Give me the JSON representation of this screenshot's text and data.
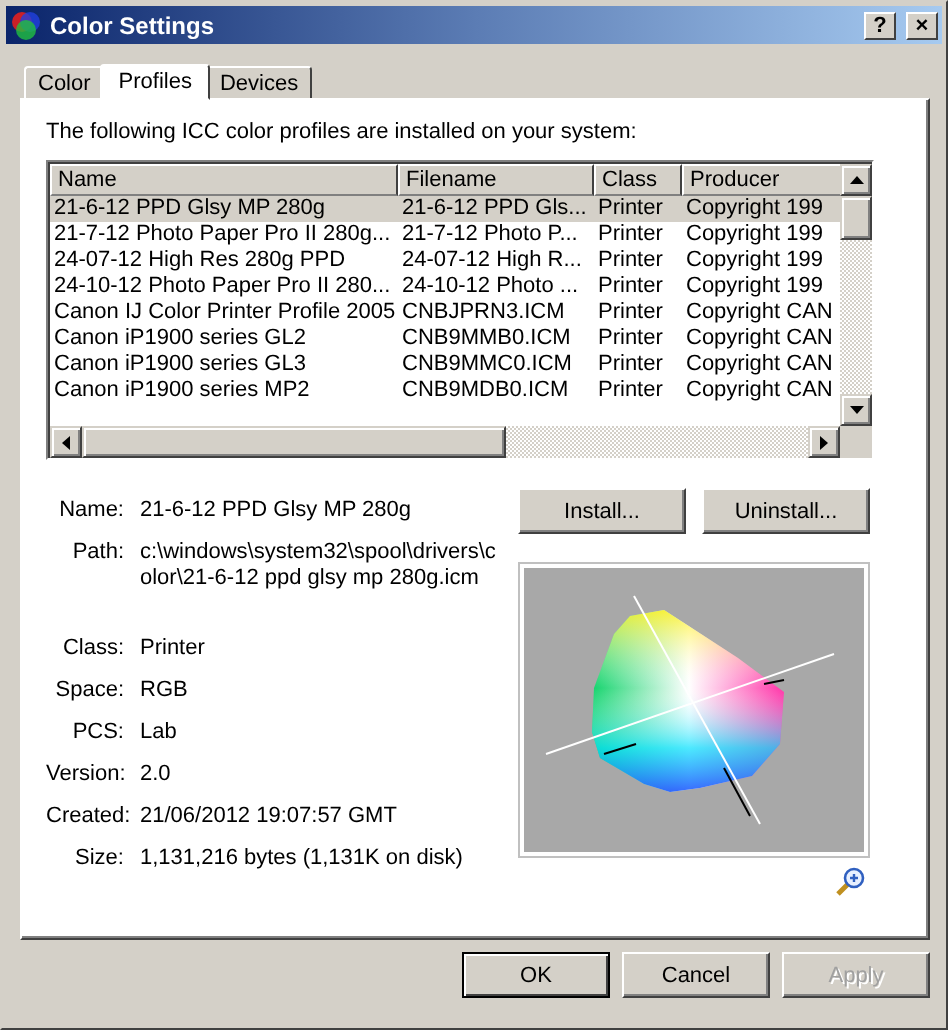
{
  "window": {
    "title": "Color Settings",
    "title_buttons": [
      "?",
      "×"
    ]
  },
  "tabs": [
    {
      "label": "Color",
      "selected": false
    },
    {
      "label": "Profiles",
      "selected": true
    },
    {
      "label": "Devices",
      "selected": false
    }
  ],
  "intro": "The following ICC color profiles are installed on your system:",
  "table": {
    "columns": [
      "Name",
      "Filename",
      "Class",
      "Producer"
    ],
    "rows": [
      {
        "cells": [
          "21-6-12 PPD Glsy MP 280g",
          "21-6-12 PPD Gls...",
          "Printer",
          "Copyright 199"
        ],
        "selected": true
      },
      {
        "cells": [
          "21-7-12 Photo Paper Pro II 280g...",
          "21-7-12 Photo P...",
          "Printer",
          "Copyright 199"
        ],
        "selected": false
      },
      {
        "cells": [
          "24-07-12 High Res 280g PPD",
          "24-07-12 High R...",
          "Printer",
          "Copyright 199"
        ],
        "selected": false
      },
      {
        "cells": [
          "24-10-12 Photo Paper Pro II 280...",
          "24-10-12 Photo ...",
          "Printer",
          "Copyright 199"
        ],
        "selected": false
      },
      {
        "cells": [
          "Canon IJ Color Printer Profile 2005",
          "CNBJPRN3.ICM",
          "Printer",
          "Copyright CAN"
        ],
        "selected": false
      },
      {
        "cells": [
          "Canon iP1900 series GL2",
          "CNB9MMB0.ICM",
          "Printer",
          "Copyright CAN"
        ],
        "selected": false
      },
      {
        "cells": [
          "Canon iP1900 series GL3",
          "CNB9MMC0.ICM",
          "Printer",
          "Copyright CAN"
        ],
        "selected": false
      },
      {
        "cells": [
          "Canon iP1900 series MP2",
          "CNB9MDB0.ICM",
          "Printer",
          "Copyright CAN"
        ],
        "selected": false
      }
    ]
  },
  "details": [
    {
      "label": "Name:",
      "value": "21-6-12 PPD Glsy MP 280g"
    },
    {
      "label": "Path:",
      "value": "c:\\windows\\system32\\spool\\drivers\\color\\21-6-12 ppd glsy mp 280g.icm"
    },
    {
      "label": "Class:",
      "value": "Printer"
    },
    {
      "label": "Space:",
      "value": "RGB"
    },
    {
      "label": "PCS:",
      "value": "Lab"
    },
    {
      "label": "Version:",
      "value": "2.0"
    },
    {
      "label": "Created:",
      "value": "21/06/2012 19:07:57 GMT"
    },
    {
      "label": "Size:",
      "value": "1,131,216 bytes (1,131K on disk)"
    }
  ],
  "actions": [
    {
      "label": "Install..."
    },
    {
      "label": "Uninstall..."
    }
  ],
  "buttons": [
    {
      "label": "OK",
      "kind": "default",
      "disabled": false
    },
    {
      "label": "Cancel",
      "kind": "normal",
      "disabled": false
    },
    {
      "label": "Apply",
      "kind": "normal",
      "disabled": true
    }
  ]
}
